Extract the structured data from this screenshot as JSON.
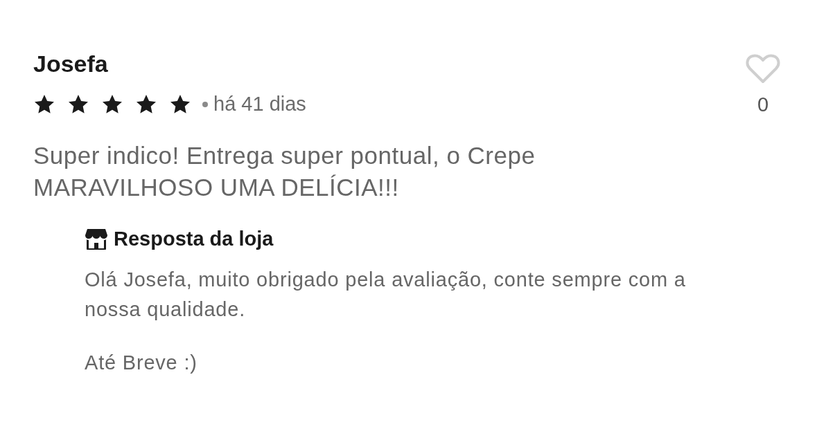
{
  "review": {
    "author": "Josefa",
    "stars": 5,
    "time": "há 41 dias",
    "text": "Super indico! Entrega super pontual, o Crepe MARAVILHOSO UMA DELÍCIA!!!",
    "liked": false,
    "like_count": "0"
  },
  "store_reply": {
    "title": "Resposta da loja",
    "paragraphs": [
      "Olá Josefa, muito obrigado pela avaliação, conte sempre com a nossa qualidade.",
      "Até Breve :)"
    ]
  }
}
